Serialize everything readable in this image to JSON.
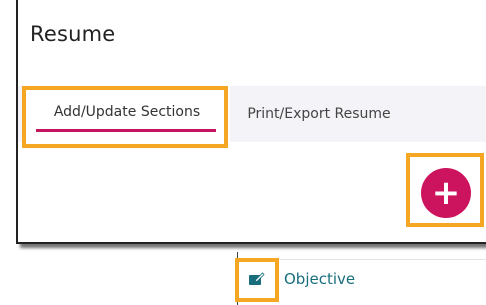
{
  "page": {
    "title": "Resume"
  },
  "tabs": [
    {
      "label": "Add/Update Sections",
      "active": true
    },
    {
      "label": "Print/Export Resume",
      "active": false
    }
  ],
  "add_button": {
    "symbol": "+",
    "color": "#cc135d"
  },
  "section_list": [
    {
      "label": "Objective",
      "icon": "edit-section-icon"
    }
  ],
  "colors": {
    "accent": "#c4145d",
    "highlight": "#f5a623",
    "link": "#196e7e"
  }
}
